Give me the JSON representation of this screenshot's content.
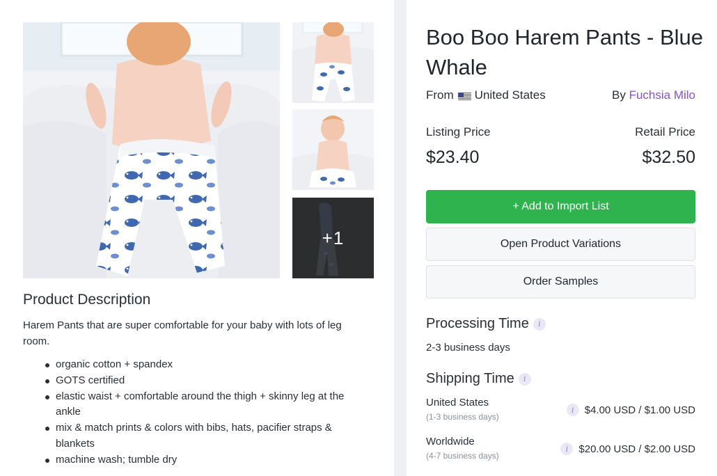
{
  "gallery": {
    "more_count_label": "+1"
  },
  "description": {
    "title": "Product Description",
    "text": "Harem Pants that are super comfortable for your baby with lots of leg room.",
    "features": [
      "organic cotton + spandex",
      "GOTS certified",
      "elastic waist + comfortable around the thigh + skinny leg at the ankle",
      "mix & match prints & colors with bibs, hats, pacifier straps & blankets",
      "machine wash; tumble dry"
    ]
  },
  "product": {
    "title": "Boo Boo Harem Pants - Blue Whale",
    "from_label": "From",
    "country": "United States",
    "by_label": "By",
    "vendor": "Fuchsia Milo"
  },
  "pricing": {
    "listing_label": "Listing Price",
    "listing_price": "$23.40",
    "retail_label": "Retail Price",
    "retail_price": "$32.50"
  },
  "actions": {
    "add_label": "+ Add to Import List",
    "variations_label": "Open Product Variations",
    "samples_label": "Order Samples"
  },
  "processing": {
    "title": "Processing Time",
    "value": "2-3 business days"
  },
  "shipping": {
    "title": "Shipping Time",
    "rows": [
      {
        "destination": "United States",
        "days": "(1-3 business days)",
        "cost": "$4.00 USD / $1.00 USD"
      },
      {
        "destination": "Worldwide",
        "days": "(4-7 business days)",
        "cost": "$20.00 USD / $2.00 USD"
      }
    ]
  },
  "colors": {
    "accent_green": "#2fb34f",
    "vendor_link": "#8a4dd8"
  }
}
